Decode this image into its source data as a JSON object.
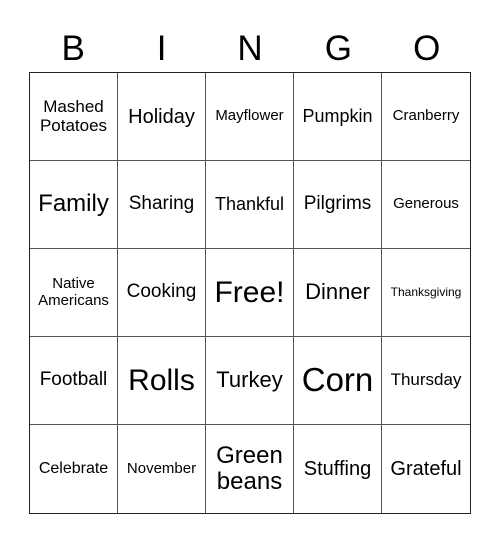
{
  "header": {
    "letters": [
      "B",
      "I",
      "N",
      "G",
      "O"
    ]
  },
  "board": {
    "cells": [
      "Mashed Potatoes",
      "Holiday",
      "Mayflower",
      "Pumpkin",
      "Cranberry",
      "Family",
      "Sharing",
      "Thankful",
      "Pilgrims",
      "Generous",
      "Native Americans",
      "Cooking",
      "Free!",
      "Dinner",
      "Thanksgiving",
      "Football",
      "Rolls",
      "Turkey",
      "Corn",
      "Thursday",
      "Celebrate",
      "November",
      "Green beans",
      "Stuffing",
      "Grateful"
    ],
    "free_space": "Free!"
  }
}
